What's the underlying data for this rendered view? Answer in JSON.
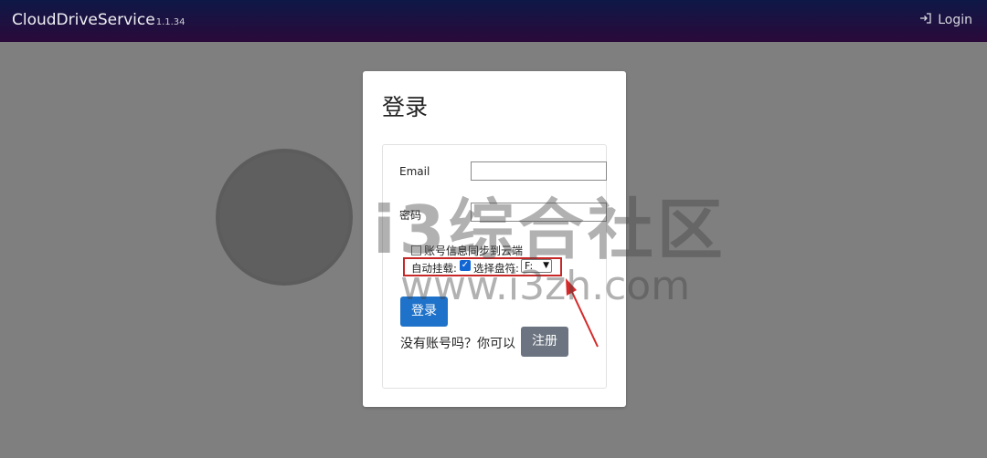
{
  "header": {
    "brand": "CloudDriveService",
    "version": "1.1.34",
    "login_label": "Login",
    "login_icon": "login-icon"
  },
  "modal": {
    "title": "登录",
    "email_label": "Email",
    "email_value": "",
    "password_label": "密码",
    "password_value": "",
    "sync_label": "账号信息同步到云端",
    "sync_checked": false,
    "automount_label": "自动挂载:",
    "automount_checked": true,
    "drive_label": "选择盘符:",
    "drive_value": "F:",
    "login_button": "登录",
    "no_account_text": "没有账号吗？你可以",
    "register_button": "注册"
  },
  "watermark": {
    "text_cn": "i3综合社区",
    "text_url": "www.i3zh.com"
  },
  "colors": {
    "header_bg": "#140f40",
    "backdrop": "#7f7f7f",
    "primary": "#1f72c9",
    "secondary": "#6b7480",
    "highlight": "#c62828"
  }
}
